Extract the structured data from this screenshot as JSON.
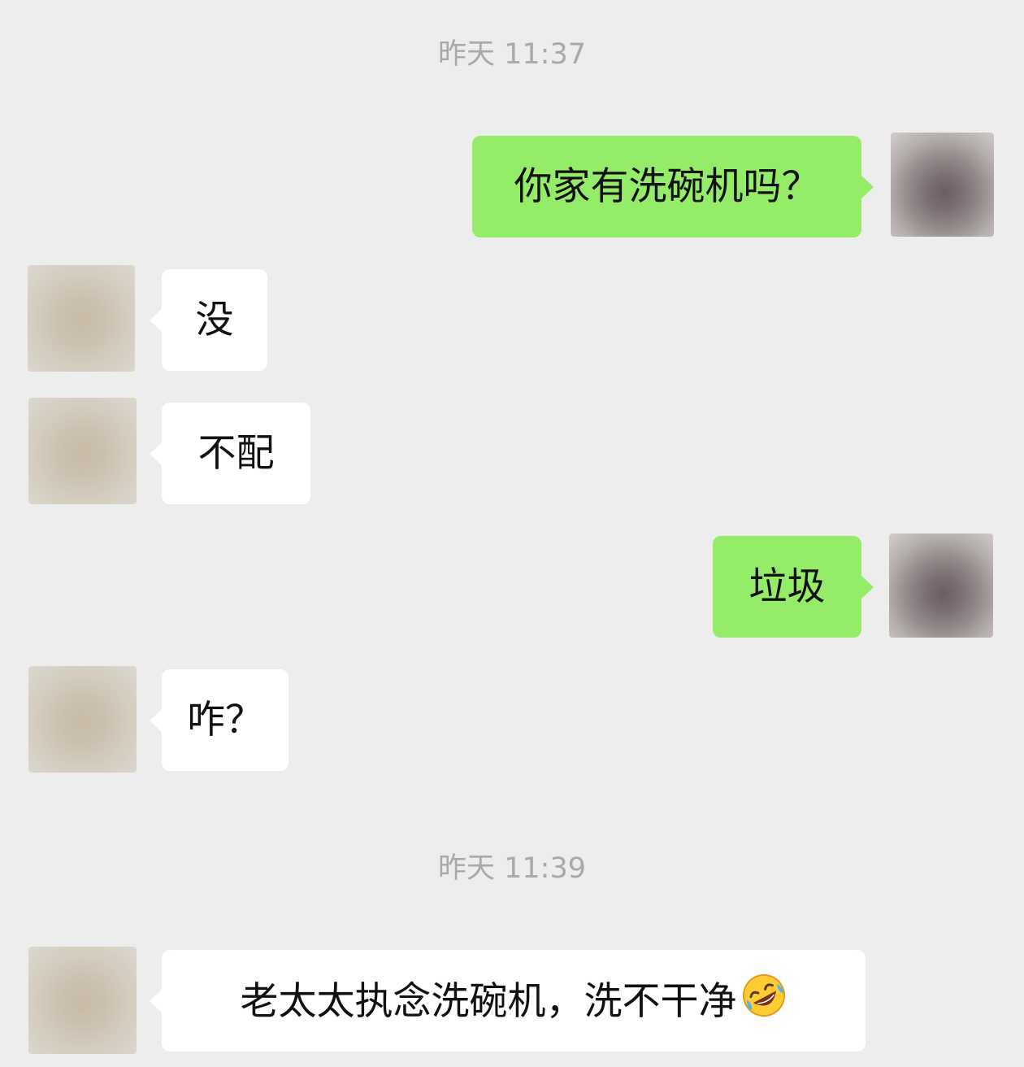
{
  "chat": {
    "timestamps": [
      "昨天 11:37",
      "昨天 11:39"
    ],
    "messages": [
      {
        "sender": "self",
        "text": "你家有洗碗机吗？"
      },
      {
        "sender": "other",
        "text": "没"
      },
      {
        "sender": "other",
        "text": "不配"
      },
      {
        "sender": "self",
        "text": "垃圾"
      },
      {
        "sender": "other",
        "text": "咋？"
      },
      {
        "sender": "other",
        "text": "老太太执念洗碗机，洗不干净",
        "emoji": "rolling-on-floor-laughing-emoji"
      }
    ]
  },
  "colors": {
    "background": "#ededed",
    "self_bubble": "#95ec69",
    "other_bubble": "#ffffff",
    "timestamp_text": "#a9a9a9",
    "message_text": "#111111"
  }
}
